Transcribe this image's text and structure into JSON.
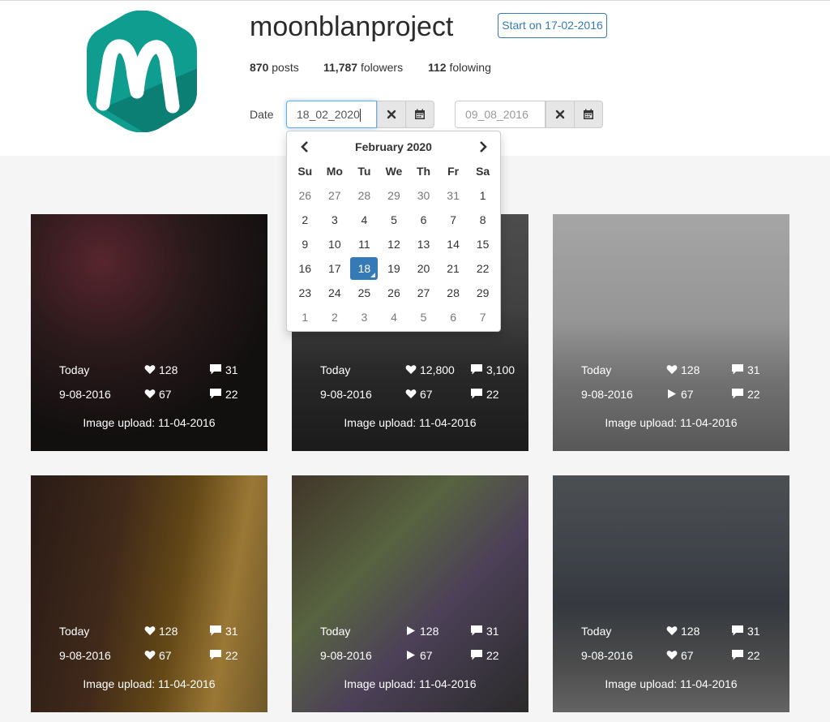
{
  "profile": {
    "username": "moonblanproject",
    "start_button": "Start on 17-02-2016",
    "posts_count": "870",
    "posts_label": "posts",
    "followers_count": "11,787",
    "followers_label": "folowers",
    "following_count": "112",
    "following_label": "folowing"
  },
  "filters": {
    "date_label": "Date",
    "from_date": "18_02_2020",
    "to_date": "09_08_2016"
  },
  "calendar": {
    "month_title": "February 2020",
    "weekdays": [
      "Su",
      "Mo",
      "Tu",
      "We",
      "Th",
      "Fr",
      "Sa"
    ],
    "weeks": [
      [
        "26",
        "27",
        "28",
        "29",
        "30",
        "31",
        "1"
      ],
      [
        "2",
        "3",
        "4",
        "5",
        "6",
        "7",
        "8"
      ],
      [
        "9",
        "10",
        "11",
        "12",
        "13",
        "14",
        "15"
      ],
      [
        "16",
        "17",
        "18",
        "19",
        "20",
        "21",
        "22"
      ],
      [
        "23",
        "24",
        "25",
        "26",
        "27",
        "28",
        "29"
      ],
      [
        "1",
        "2",
        "3",
        "4",
        "5",
        "6",
        "7"
      ]
    ],
    "selected_day": "18"
  },
  "posts": [
    {
      "today_label": "Today",
      "today_likes": "128",
      "today_comments": "31",
      "date": "9-08-2016",
      "date_likes": "67",
      "date_comments": "22",
      "upload_text": "Image upload: 11-04-2016",
      "today_icon": "heart-icon",
      "date_icon": "heart-icon"
    },
    {
      "today_label": "Today",
      "today_likes": "12,800",
      "today_comments": "3,100",
      "date": "9-08-2016",
      "date_likes": "67",
      "date_comments": "22",
      "upload_text": "Image upload: 11-04-2016",
      "today_icon": "heart-icon",
      "date_icon": "heart-icon"
    },
    {
      "today_label": "Today",
      "today_likes": "128",
      "today_comments": "31",
      "date": "9-08-2016",
      "date_likes": "67",
      "date_comments": "22",
      "upload_text": "Image upload: 11-04-2016",
      "today_icon": "heart-icon",
      "date_icon": "play-icon"
    },
    {
      "today_label": "Today",
      "today_likes": "128",
      "today_comments": "31",
      "date": "9-08-2016",
      "date_likes": "67",
      "date_comments": "22",
      "upload_text": "Image upload: 11-04-2016",
      "today_icon": "heart-icon",
      "date_icon": "heart-icon"
    },
    {
      "today_label": "Today",
      "today_likes": "128",
      "today_comments": "31",
      "date": "9-08-2016",
      "date_likes": "67",
      "date_comments": "22",
      "upload_text": "Image upload: 11-04-2016",
      "today_icon": "play-icon",
      "date_icon": "play-icon"
    },
    {
      "today_label": "Today",
      "today_likes": "128",
      "today_comments": "31",
      "date": "9-08-2016",
      "date_likes": "67",
      "date_comments": "22",
      "upload_text": "Image upload: 11-04-2016",
      "today_icon": "heart-icon",
      "date_icon": "heart-icon"
    }
  ],
  "colors": {
    "accent": "#337ab7",
    "logo_teal": "#0f9d8f"
  }
}
